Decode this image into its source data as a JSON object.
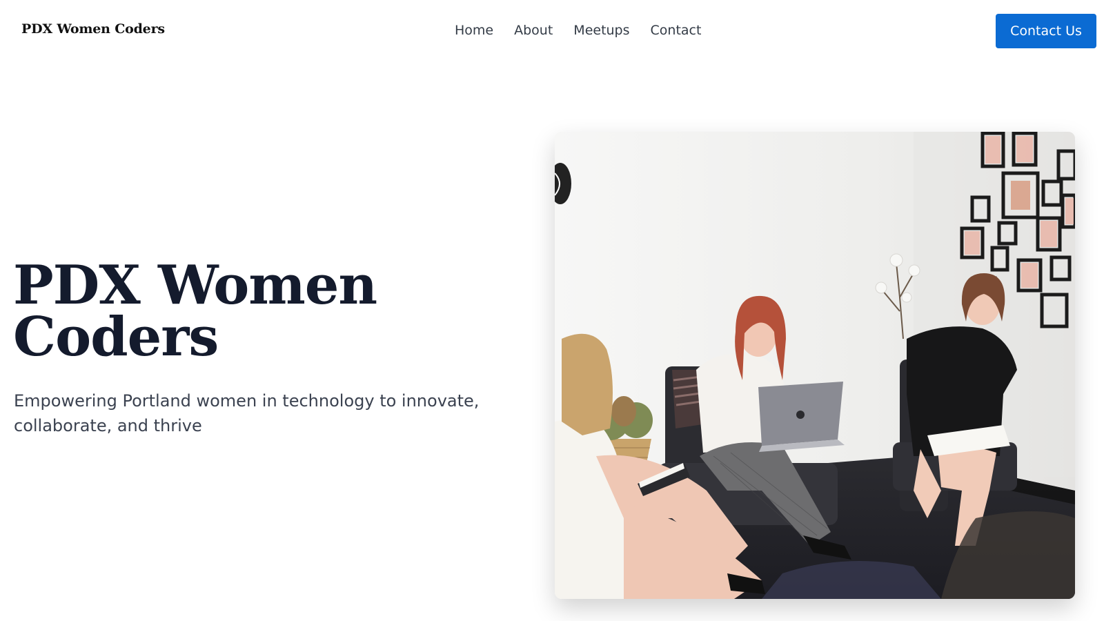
{
  "header": {
    "brand": "PDX Women Coders",
    "nav": [
      "Home",
      "About",
      "Meetups",
      "Contact"
    ],
    "cta_label": "Contact Us"
  },
  "hero": {
    "title_line1": "PDX Women",
    "title_line2": "Coders",
    "subtitle": "Empowering Portland women in technology to innovate, collaborate, and thrive"
  },
  "colors": {
    "accent": "#0b6bd3",
    "title": "#141b2d",
    "body_text": "#3b4250"
  }
}
